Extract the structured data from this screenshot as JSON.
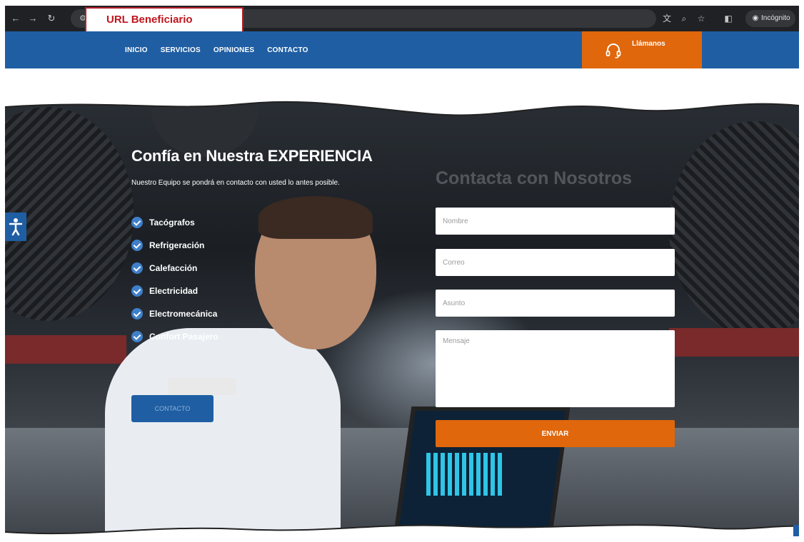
{
  "annotation": {
    "url_label": "URL Beneficiario"
  },
  "browser": {
    "incognito_label": "Incógnito"
  },
  "nav": {
    "items": [
      "INICIO",
      "SERVICIOS",
      "OPINIONES",
      "CONTACTO"
    ]
  },
  "call": {
    "label": "Llámanos"
  },
  "hero": {
    "title": "Confía en Nuestra EXPERIENCIA",
    "subtitle": "Nuestro Equipo se pondrá en contacto con usted lo antes posible.",
    "services": [
      "Tacógrafos",
      "Refrigeración",
      "Calefacción",
      "Electricidad",
      "Electromecánica",
      "Confort Pasajero"
    ],
    "contact_button": "CONTACTO"
  },
  "form": {
    "title": "Contacta con Nosotros",
    "name_placeholder": "Nombre",
    "email_placeholder": "Correo",
    "subject_placeholder": "Asunto",
    "message_placeholder": "Mensaje",
    "submit_label": "ENVIAR"
  },
  "colors": {
    "brand_blue": "#1f5ea3",
    "accent_orange": "#e0670c",
    "annotation_red": "#c0151d"
  },
  "icons": {
    "accessibility": "accessibility-icon",
    "headset": "headset-icon",
    "check": "check-circle-icon"
  }
}
